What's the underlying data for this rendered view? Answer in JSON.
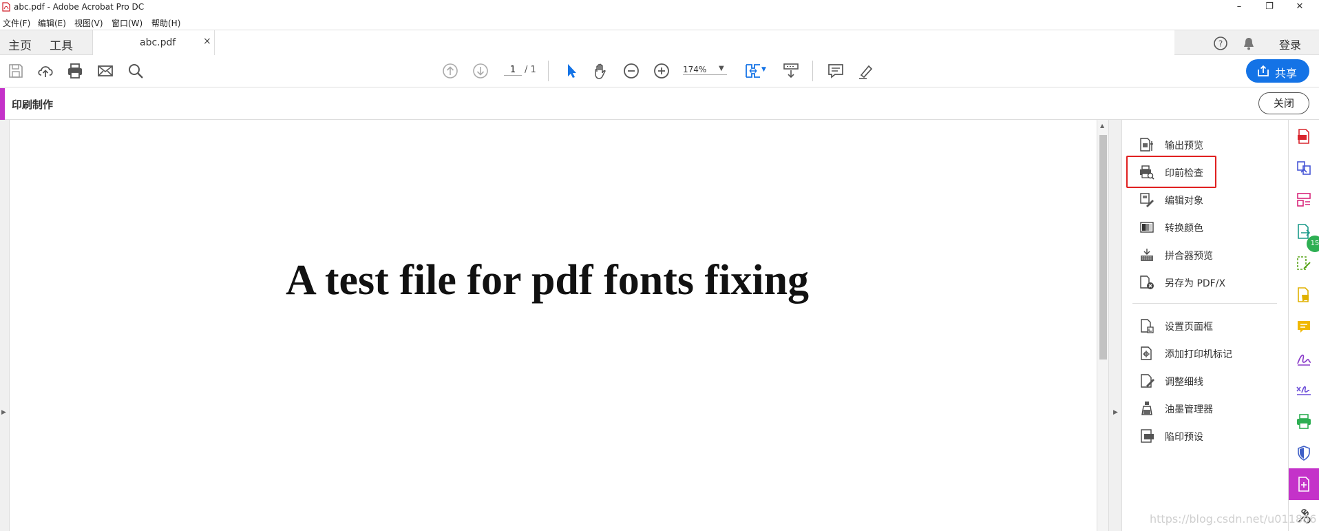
{
  "window": {
    "title": "abc.pdf - Adobe Acrobat Pro DC"
  },
  "menu": {
    "items": [
      "文件(F)",
      "编辑(E)",
      "视图(V)",
      "窗口(W)",
      "帮助(H)"
    ]
  },
  "tabs": {
    "home": "主页",
    "tools": "工具",
    "document": "abc.pdf",
    "close": "×"
  },
  "header_right": {
    "login": "登录"
  },
  "toolbar": {
    "page_current": "1",
    "page_total": "/ 1",
    "zoom": "174%",
    "share": "共享"
  },
  "tool": {
    "title": "印刷制作",
    "close": "关闭"
  },
  "document": {
    "text": "A test file for pdf fonts fixing"
  },
  "panel": {
    "items": [
      {
        "label": "输出预览",
        "icon": "output-preview-icon"
      },
      {
        "label": "印前检查",
        "icon": "preflight-icon"
      },
      {
        "label": "编辑对象",
        "icon": "edit-object-icon"
      },
      {
        "label": "转换颜色",
        "icon": "convert-colors-icon"
      },
      {
        "label": "拼合器预览",
        "icon": "flattener-preview-icon"
      },
      {
        "label": "另存为 PDF/X",
        "icon": "save-as-pdfx-icon"
      },
      {
        "label": "设置页面框",
        "icon": "set-page-boxes-icon"
      },
      {
        "label": "添加打印机标记",
        "icon": "add-printer-marks-icon"
      },
      {
        "label": "调整细线",
        "icon": "fix-hairlines-icon"
      },
      {
        "label": "油墨管理器",
        "icon": "ink-manager-icon"
      },
      {
        "label": "陷印预设",
        "icon": "trap-presets-icon"
      }
    ],
    "highlighted": "印前检查"
  },
  "sidebar": {
    "badge": "15"
  },
  "watermark": "https://blog.csdn.net/u011886",
  "colors": {
    "accent": "#c432c9",
    "share": "#1473e6",
    "highlight": "#e02020"
  }
}
